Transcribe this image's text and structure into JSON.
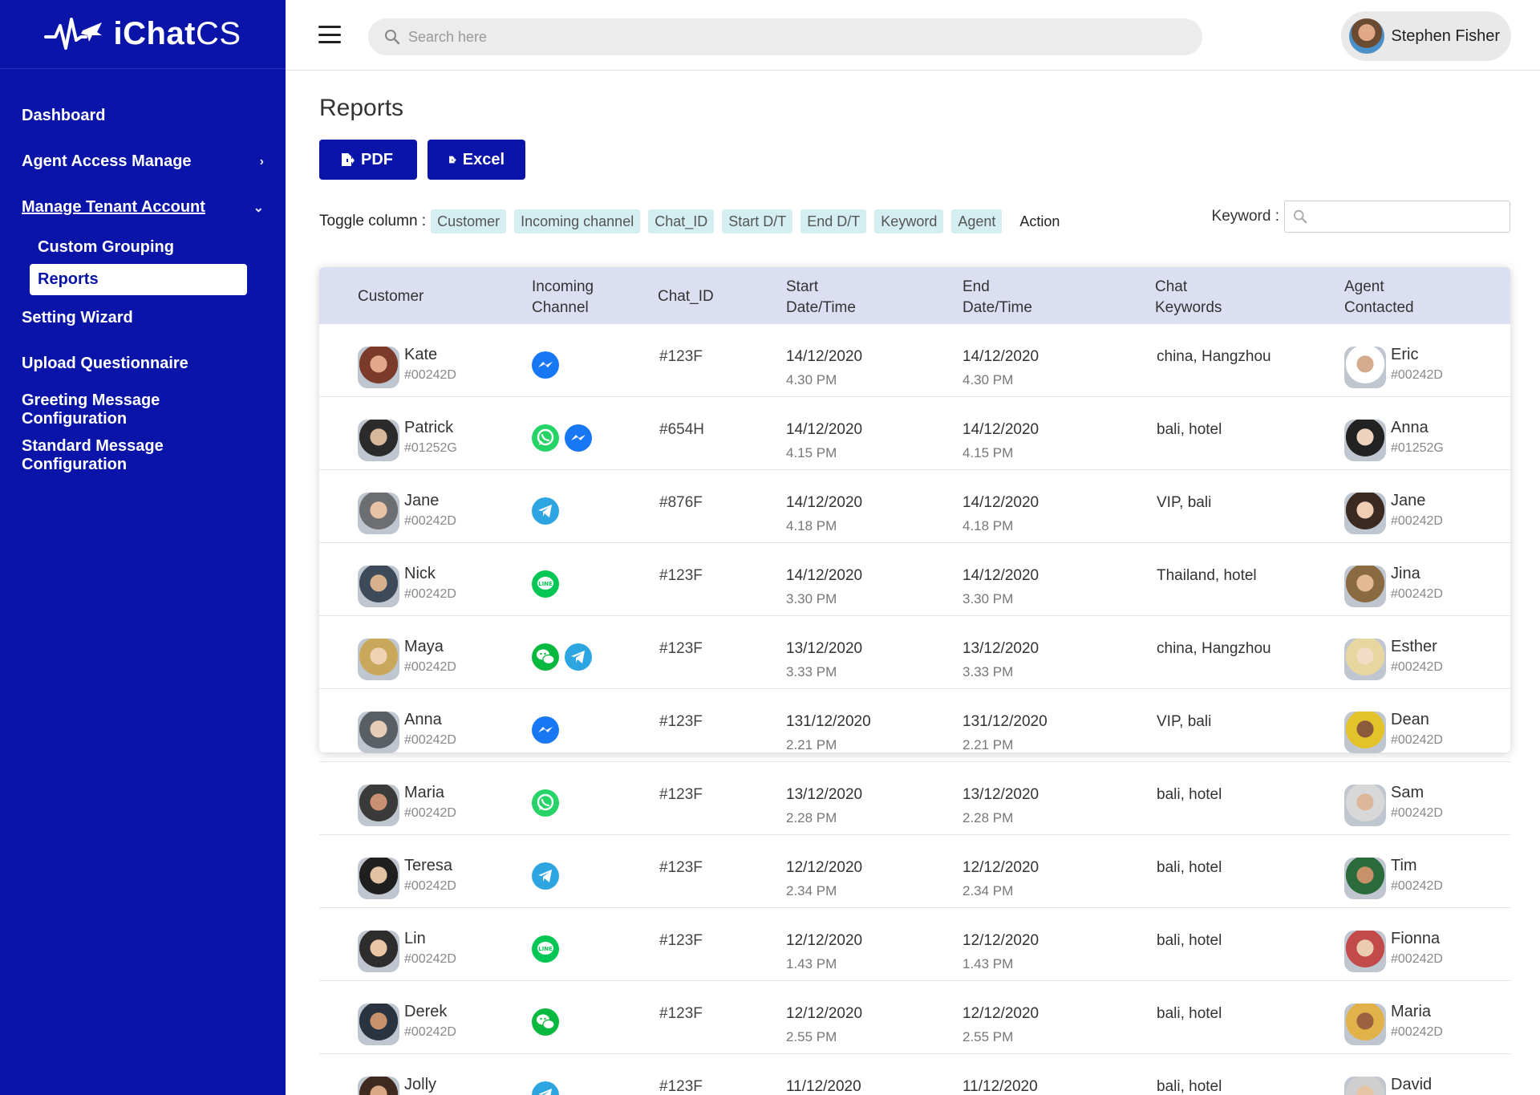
{
  "brand": {
    "bold": "iChat",
    "light": "CS"
  },
  "sidebar": {
    "items": [
      {
        "label": "Dashboard",
        "chevron": ""
      },
      {
        "label": "Agent Access Manage",
        "chevron": "›"
      },
      {
        "label": "Manage Tenant Account",
        "chevron": "⌄"
      }
    ],
    "sub_items": [
      {
        "label": "Custom Grouping"
      },
      {
        "label": "Reports"
      }
    ],
    "items_after": [
      {
        "label": "Setting Wizard"
      },
      {
        "label": "Upload Questionnaire"
      },
      {
        "label": "Greeting Message Configuration"
      },
      {
        "label": "Standard Message Configuration"
      }
    ]
  },
  "topbar": {
    "search_placeholder": "Search here",
    "user_name": "Stephen Fisher"
  },
  "main": {
    "title": "Reports",
    "pdf_label": "PDF",
    "excel_label": "Excel",
    "toggle_label": "Toggle column :",
    "toggle_chips": [
      "Customer",
      "Incoming channel",
      "Chat_ID",
      "Start D/T",
      "End D/T",
      "Keyword",
      "Agent"
    ],
    "toggle_plain": "Action",
    "keyword_label": "Keyword :"
  },
  "table": {
    "headers": {
      "customer": "Customer",
      "channel_1": "Incoming",
      "channel_2": "Channel",
      "chat_id": "Chat_ID",
      "start_1": "Start",
      "start_2": "Date/Time",
      "end_1": "End",
      "end_2": "Date/Time",
      "kw_1": "Chat",
      "kw_2": "Keywords",
      "agent_1": "Agent",
      "agent_2": "Contacted"
    },
    "rows": [
      {
        "customer": "Kate",
        "customer_id": "#00242D",
        "channels": [
          "messenger"
        ],
        "chat_id": "#123F",
        "start_date": "14/12/2020",
        "start_time": "4.30 PM",
        "end_date": "14/12/2020",
        "end_time": "4.30 PM",
        "keywords": "china, Hangzhou",
        "agent": "Eric",
        "agent_id": "#00242D"
      },
      {
        "customer": "Patrick",
        "customer_id": "#01252G",
        "channels": [
          "whatsapp",
          "messenger"
        ],
        "chat_id": "#654H",
        "start_date": "14/12/2020",
        "start_time": "4.15 PM",
        "end_date": "14/12/2020",
        "end_time": "4.15 PM",
        "keywords": "bali, hotel",
        "agent": "Anna",
        "agent_id": "#01252G"
      },
      {
        "customer": "Jane",
        "customer_id": "#00242D",
        "channels": [
          "telegram"
        ],
        "chat_id": "#876F",
        "start_date": "14/12/2020",
        "start_time": "4.18 PM",
        "end_date": "14/12/2020",
        "end_time": "4.18 PM",
        "keywords": "VIP, bali",
        "agent": "Jane",
        "agent_id": "#00242D"
      },
      {
        "customer": "Nick",
        "customer_id": "#00242D",
        "channels": [
          "line"
        ],
        "chat_id": "#123F",
        "start_date": "14/12/2020",
        "start_time": "3.30 PM",
        "end_date": "14/12/2020",
        "end_time": "3.30 PM",
        "keywords": "Thailand, hotel",
        "agent": "Jina",
        "agent_id": "#00242D"
      },
      {
        "customer": "Maya",
        "customer_id": "#00242D",
        "channels": [
          "wechat",
          "telegram"
        ],
        "chat_id": "#123F",
        "start_date": "13/12/2020",
        "start_time": "3.33 PM",
        "end_date": "13/12/2020",
        "end_time": "3.33 PM",
        "keywords": "china, Hangzhou",
        "agent": "Esther",
        "agent_id": "#00242D"
      },
      {
        "customer": "Anna",
        "customer_id": "#00242D",
        "channels": [
          "messenger"
        ],
        "chat_id": "#123F",
        "start_date": "131/12/2020",
        "start_time": "2.21 PM",
        "end_date": "131/12/2020",
        "end_time": "2.21 PM",
        "keywords": "VIP, bali",
        "agent": "Dean",
        "agent_id": "#00242D"
      },
      {
        "customer": "Maria",
        "customer_id": "#00242D",
        "channels": [
          "whatsapp"
        ],
        "chat_id": "#123F",
        "start_date": "13/12/2020",
        "start_time": "2.28 PM",
        "end_date": "13/12/2020",
        "end_time": "2.28 PM",
        "keywords": "bali, hotel",
        "agent": "Sam",
        "agent_id": "#00242D"
      },
      {
        "customer": "Teresa",
        "customer_id": "#00242D",
        "channels": [
          "telegram"
        ],
        "chat_id": "#123F",
        "start_date": "12/12/2020",
        "start_time": "2.34 PM",
        "end_date": "12/12/2020",
        "end_time": "2.34 PM",
        "keywords": "bali, hotel",
        "agent": "Tim",
        "agent_id": "#00242D"
      },
      {
        "customer": "Lin",
        "customer_id": "#00242D",
        "channels": [
          "line"
        ],
        "chat_id": "#123F",
        "start_date": "12/12/2020",
        "start_time": "1.43 PM",
        "end_date": "12/12/2020",
        "end_time": "1.43 PM",
        "keywords": "bali, hotel",
        "agent": "Fionna",
        "agent_id": "#00242D"
      },
      {
        "customer": "Derek",
        "customer_id": "#00242D",
        "channels": [
          "wechat"
        ],
        "chat_id": "#123F",
        "start_date": "12/12/2020",
        "start_time": "2.55 PM",
        "end_date": "12/12/2020",
        "end_time": "2.55 PM",
        "keywords": "bali, hotel",
        "agent": "Maria",
        "agent_id": "#00242D"
      },
      {
        "customer": "Jolly",
        "customer_id": "",
        "channels": [
          "telegram"
        ],
        "chat_id": "#123F",
        "start_date": "11/12/2020",
        "start_time": "",
        "end_date": "11/12/2020",
        "end_time": "",
        "keywords": "bali, hotel",
        "agent": "David",
        "agent_id": ""
      }
    ]
  },
  "colors": {
    "brand": "#0a14a8",
    "header_bg": "#dcdff2",
    "chip_bg": "#d4eef1",
    "messenger": "#1877f2",
    "whatsapp": "#25d366",
    "telegram": "#2ca5e0",
    "line": "#06c755",
    "wechat": "#09b83e"
  }
}
